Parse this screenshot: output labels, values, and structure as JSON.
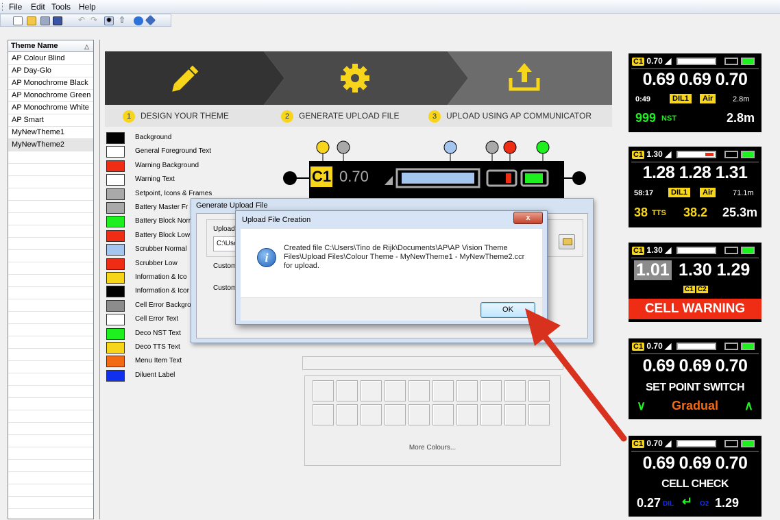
{
  "menu": {
    "file": "File",
    "edit": "Edit",
    "tools": "Tools",
    "help": "Help"
  },
  "theme_list": {
    "header": "Theme Name",
    "items": [
      "AP Colour Blind",
      "AP Day-Glo",
      "AP Monochrome Black",
      "AP Monochrome Green",
      "AP Monochrome White",
      "AP Smart",
      "MyNewTheme1",
      "MyNewTheme2"
    ],
    "selected": "MyNewTheme2"
  },
  "banner": {
    "steps": [
      {
        "num": "1",
        "label": "DESIGN YOUR THEME"
      },
      {
        "num": "2",
        "label": "GENERATE UPLOAD FILE"
      },
      {
        "num": "3",
        "label": "UPLOAD USING AP COMMUNICATOR"
      }
    ]
  },
  "colors": [
    {
      "label": "Background",
      "color": "#000000"
    },
    {
      "label": "General Foreground Text",
      "color": "#ffffff"
    },
    {
      "label": "Warning Background",
      "color": "#ee2d14"
    },
    {
      "label": "Warning Text",
      "color": "#ffffff"
    },
    {
      "label": "Setpoint, Icons & Frames",
      "color": "#a9a9a9"
    },
    {
      "label": "Battery Master Fr",
      "color": "#a9a9a9"
    },
    {
      "label": "Battery Block Norr",
      "color": "#1eef1e"
    },
    {
      "label": "Battery Block Low",
      "color": "#ee2d14"
    },
    {
      "label": "Scrubber Normal",
      "color": "#a4c6ee"
    },
    {
      "label": "Scrubber Low",
      "color": "#ee2d14"
    },
    {
      "label": "Information & Ico",
      "color": "#f7d51b"
    },
    {
      "label": "Information & Icor",
      "color": "#000000"
    },
    {
      "label": "Cell Error Backgro",
      "color": "#8c8c8c"
    },
    {
      "label": "Cell Error Text",
      "color": "#ffffff"
    },
    {
      "label": "Deco NST Text",
      "color": "#1eef1e"
    },
    {
      "label": "Deco TTS Text",
      "color": "#f7d51b"
    },
    {
      "label": "Menu Item Text",
      "color": "#f26a13"
    },
    {
      "label": "Diluent Label",
      "color": "#1030ee"
    }
  ],
  "preview": {
    "c1": "C1",
    "ppo2": "0.70"
  },
  "generate_dialog": {
    "title": "Generate Upload File",
    "upload_label": "Upload F",
    "path_value": "C:\\Use",
    "custom1": "Custom",
    "custom2": "Custom"
  },
  "upload_dialog": {
    "title": "Upload File Creation",
    "close": "x",
    "message": "Created file C:\\Users\\Tino de Rijk\\Documents\\AP\\AP Vision Theme Files\\Upload Files\\Colour Theme - MyNewTheme1 - MyNewTheme2.ccr for upload.",
    "ok": "OK"
  },
  "palette": {
    "more": "More Colours..."
  },
  "screens": [
    {
      "c1": "C1",
      "top_ppo2": "0.70",
      "vals": "0.69 0.69 0.70",
      "time": "0:49",
      "dil": "DIL1",
      "gas": "Air",
      "depth_small": "2.8m",
      "nst": "999",
      "nst_label": "NST",
      "depth": "2.8m"
    },
    {
      "c1": "C1",
      "top_ppo2": "1.30",
      "vals": "1.28 1.28 1.31",
      "time": "58:17",
      "dil": "DIL1",
      "gas": "Air",
      "depth_small": "71.1m",
      "tts": "38",
      "tts_label": "TTS",
      "tts_val": "38.2",
      "depth": "25.3m"
    },
    {
      "c1": "C1",
      "top_ppo2": "1.30",
      "v1": "1.01",
      "v23": "1.30 1.29",
      "cells": [
        "C1",
        "C2"
      ],
      "warning": "CELL WARNING"
    },
    {
      "c1": "C1",
      "top_ppo2": "0.70",
      "vals": "0.69 0.69 0.70",
      "switch": "SET POINT SWITCH",
      "mode": "Gradual"
    },
    {
      "c1": "C1",
      "top_ppo2": "0.70",
      "vals": "0.69 0.69 0.70",
      "check": "CELL CHECK",
      "dil_val": "0.27",
      "dil_label": "DIL",
      "o2_label": "O2",
      "o2_val": "1.29"
    }
  ]
}
